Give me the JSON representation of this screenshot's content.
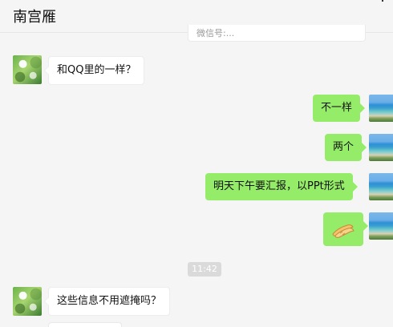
{
  "header": {
    "title": "南宫雁"
  },
  "top_partial_message": {
    "text": "微信号:..."
  },
  "messages": [
    {
      "side": "left",
      "text": "和QQ里的一样？",
      "avatar": "leaf-avatar"
    },
    {
      "side": "right",
      "text": "不一样",
      "avatar": "beach-avatar"
    },
    {
      "side": "right",
      "text": "两个",
      "avatar": "beach-avatar"
    },
    {
      "side": "right",
      "text": "明天下午要汇报，以PPt形式",
      "avatar": "beach-avatar"
    },
    {
      "side": "right",
      "emoji": "handshake-emoji",
      "avatar": "beach-avatar"
    },
    {
      "side": "left",
      "text": "这些信息不用遮掩吗？",
      "avatar": "leaf-avatar"
    }
  ],
  "timestamp": "11:42",
  "colors": {
    "chat_background": "#f5f5f5",
    "right_bubble": "#95ec69",
    "left_bubble": "#ffffff",
    "timestamp_background": "#dadada"
  }
}
